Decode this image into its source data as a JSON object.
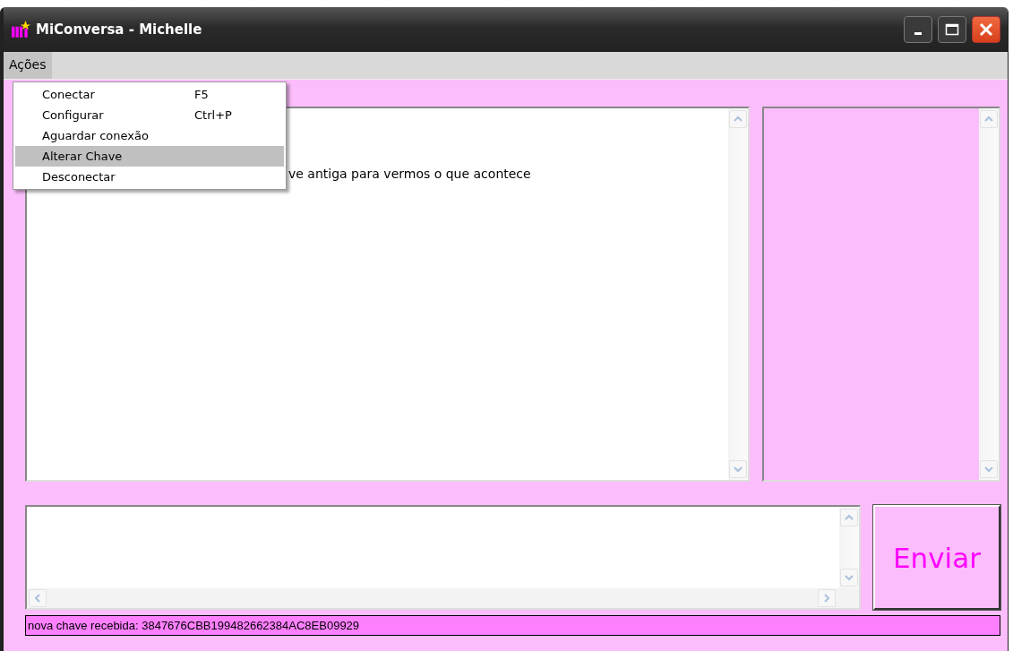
{
  "window": {
    "title": "MiConversa - Michelle"
  },
  "menu_bar": [
    {
      "label": "Ações",
      "selected": true
    }
  ],
  "open_menu": {
    "items": [
      {
        "label": "Conectar",
        "shortcut": "F5",
        "selected": false
      },
      {
        "label": "Configurar",
        "shortcut": "Ctrl+P",
        "selected": false
      },
      {
        "label": "Aguardar conexão",
        "selected": false
      },
      {
        "label": "Alterar Chave",
        "selected": true
      },
      {
        "label": "Desconectar",
        "selected": false
      }
    ]
  },
  "chat_log": {
    "lines": [
      "ve antiga para vermos o que acontece"
    ]
  },
  "send_button": "Enviar",
  "status_bar": "nova chave recebida: 3847676CBB199482662384AC8EB09929"
}
